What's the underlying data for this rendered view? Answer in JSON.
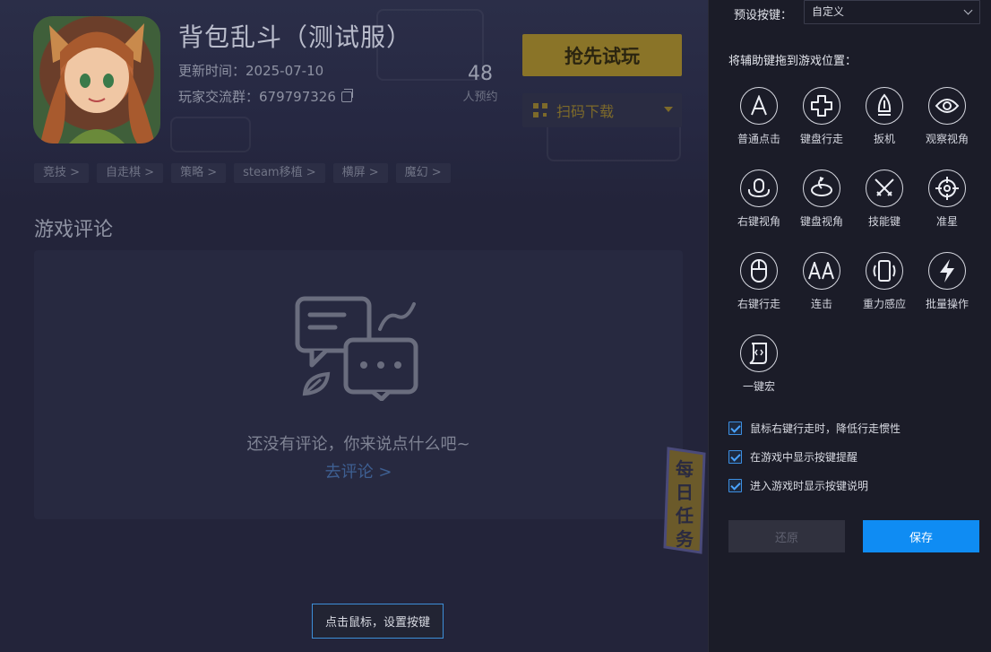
{
  "game": {
    "title": "背包乱斗（测试服）",
    "update_time": "更新时间：2025-07-10",
    "player_group": "玩家交流群：679797326",
    "reserve_count": "48",
    "reserve_label": "人预约",
    "try_button": "抢先试玩",
    "download_button": "扫码下载",
    "tags": [
      "竞技 >",
      "自走棋 >",
      "策略 >",
      "steam移植 >",
      "横屏 >",
      "魔幻 >"
    ],
    "section_title": "游戏评论",
    "empty_text": "还没有评论，你来说点什么吧~",
    "go_comment": "去评论 >",
    "daily_task": "每日任务"
  },
  "hint_toast": "点击鼠标，设置按键",
  "panel": {
    "preset_label": "预设按键：",
    "preset_value": "自定义",
    "drag_tip": "将辅助键拖到游戏位置：",
    "keys": [
      {
        "label": "普通点击",
        "icon": "letter-a-icon"
      },
      {
        "label": "键盘行走",
        "icon": "dpad-icon"
      },
      {
        "label": "扳机",
        "icon": "trigger-icon"
      },
      {
        "label": "观察视角",
        "icon": "eye-icon"
      },
      {
        "label": "右键视角",
        "icon": "mouse-orbit-icon"
      },
      {
        "label": "键盘视角",
        "icon": "rotate-view-icon"
      },
      {
        "label": "技能键",
        "icon": "crossed-swords-icon"
      },
      {
        "label": "准星",
        "icon": "crosshair-icon"
      },
      {
        "label": "右键行走",
        "icon": "mouse-icon"
      },
      {
        "label": "连击",
        "icon": "double-a-icon"
      },
      {
        "label": "重力感应",
        "icon": "phone-tilt-icon"
      },
      {
        "label": "批量操作",
        "icon": "lightning-icon"
      },
      {
        "label": "一键宏",
        "icon": "macro-script-icon"
      }
    ],
    "options": [
      {
        "label": "鼠标右键行走时，降低行走惯性",
        "checked": true
      },
      {
        "label": "在游戏中显示按键提醒",
        "checked": true
      },
      {
        "label": "进入游戏时显示按键说明",
        "checked": true
      }
    ],
    "restore_button": "还原",
    "save_button": "保存"
  }
}
